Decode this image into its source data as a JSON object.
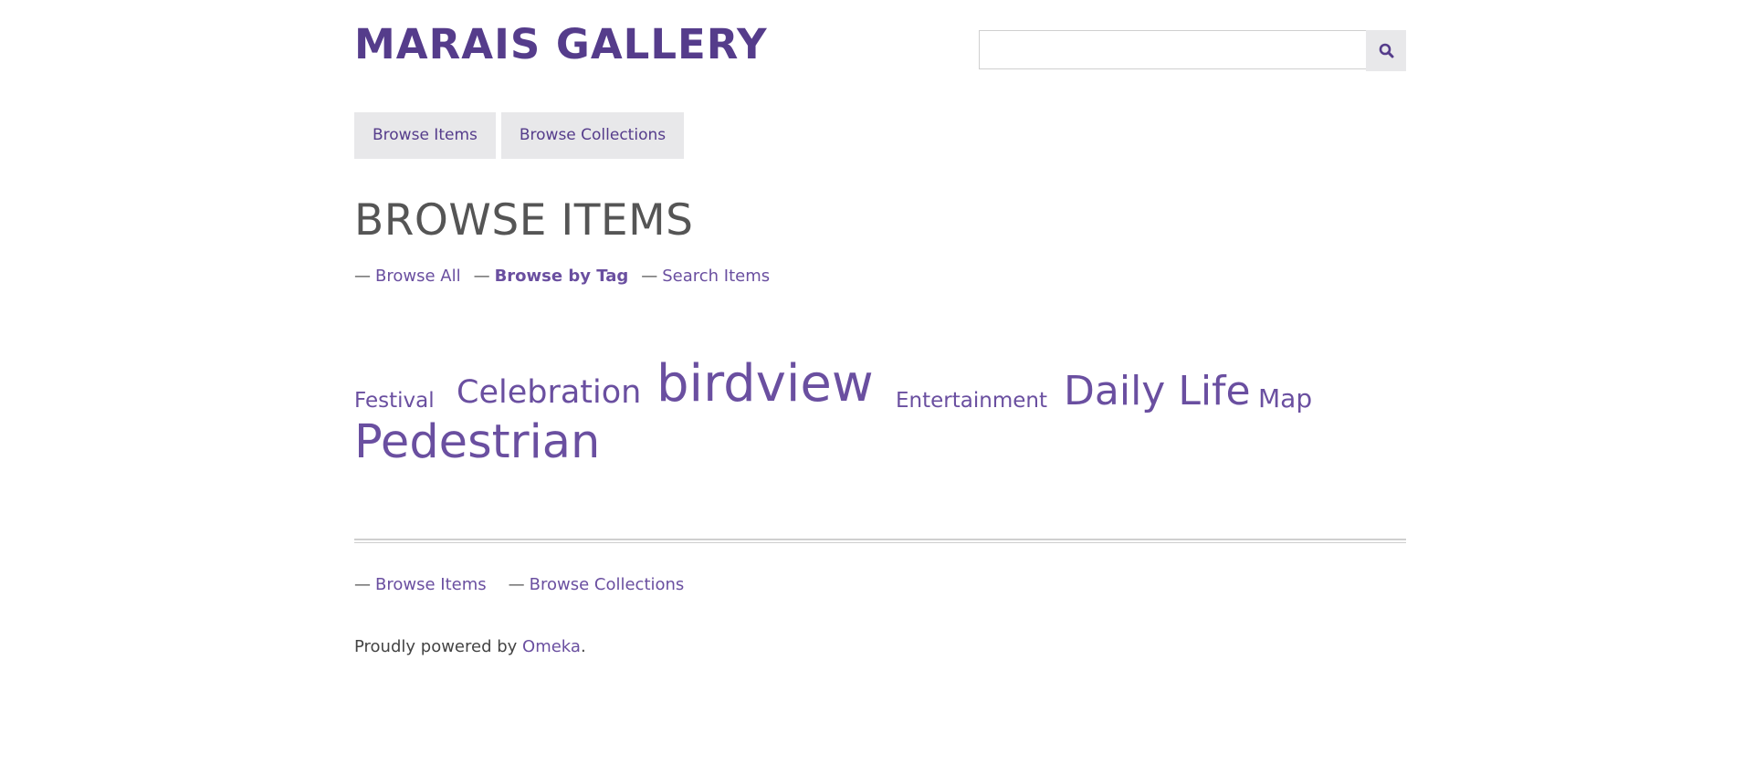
{
  "site": {
    "title": "MARAIS GALLERY"
  },
  "search": {
    "placeholder": "",
    "value": "",
    "button_icon": "search-icon"
  },
  "top_nav": {
    "items": [
      {
        "label": "Browse Items"
      },
      {
        "label": "Browse Collections"
      }
    ]
  },
  "page": {
    "heading": "BROWSE ITEMS"
  },
  "sub_nav": {
    "dash": "—",
    "items": [
      {
        "label": "Browse All",
        "current": false
      },
      {
        "label": "Browse by Tag",
        "current": true
      },
      {
        "label": "Search Items",
        "current": false
      }
    ]
  },
  "tags": [
    {
      "label": "Festival"
    },
    {
      "label": "Celebration"
    },
    {
      "label": "birdview"
    },
    {
      "label": "Entertainment"
    },
    {
      "label": "Daily Life"
    },
    {
      "label": "Map"
    },
    {
      "label": "Pedestrian"
    }
  ],
  "footer": {
    "dash": "—",
    "nav": [
      {
        "label": "Browse Items"
      },
      {
        "label": "Browse Collections"
      }
    ],
    "powered_prefix": "Proudly powered by ",
    "powered_link": "Omeka",
    "powered_suffix": "."
  },
  "colors": {
    "accent": "#553c8b",
    "link": "#6a4fa0",
    "tab_bg": "#e8e8ea",
    "heading": "#555555"
  }
}
